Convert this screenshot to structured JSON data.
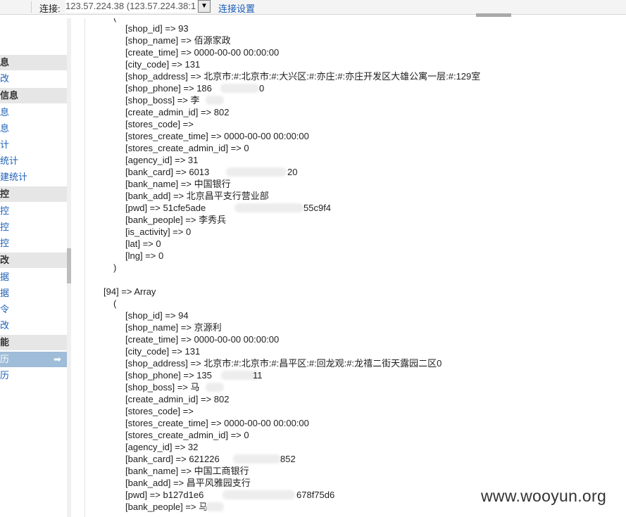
{
  "topbar": {
    "connection_label": "连接:",
    "connection_value": "123.57.224.38 (123.57.224.38:1",
    "dropdown_glyph": "▼",
    "settings_link": "连接设置"
  },
  "sidebar": {
    "items": [
      {
        "label": "息",
        "kind": "header"
      },
      {
        "label": "改",
        "kind": "link"
      },
      {
        "label": "信息",
        "kind": "header"
      },
      {
        "label": "息",
        "kind": "link"
      },
      {
        "label": "息",
        "kind": "link"
      },
      {
        "label": "计",
        "kind": "link"
      },
      {
        "label": "统计",
        "kind": "link"
      },
      {
        "label": "建统计",
        "kind": "link"
      },
      {
        "label": "控",
        "kind": "header"
      },
      {
        "label": "控",
        "kind": "link"
      },
      {
        "label": "控",
        "kind": "link"
      },
      {
        "label": "控",
        "kind": "link"
      },
      {
        "label": "改",
        "kind": "header"
      },
      {
        "label": "据",
        "kind": "link"
      },
      {
        "label": "据",
        "kind": "link"
      },
      {
        "label": "令",
        "kind": "link"
      },
      {
        "label": "改",
        "kind": "link"
      },
      {
        "label": "能",
        "kind": "header"
      },
      {
        "label": "历",
        "kind": "active"
      },
      {
        "label": "历",
        "kind": "link"
      }
    ],
    "active_arrow": "➡"
  },
  "content": {
    "top_paren": "(",
    "record_93": {
      "lines": [
        "[shop_id] => 93",
        "[shop_name] => 佰源家政",
        "[create_time] => 0000-00-00 00:00:00",
        "[city_code] => 131",
        "[shop_address] => 北京市:#:北京市:#:大兴区:#:亦庄:#:亦庄开发区大雄公寓一层:#:129室",
        "[shop_phone] => 186",
        "[shop_boss] => 李",
        "[create_admin_id] => 802",
        "[stores_code] =>",
        "[stores_create_time] => 0000-00-00 00:00:00",
        "[stores_create_admin_id] => 0",
        "[agency_id] => 31",
        "[bank_card] => 6013",
        "[bank_name] => 中国银行",
        "[bank_add] => 北京昌平支行营业部",
        "[pwd] => 51cfe5ade",
        "[bank_people] => 李秀兵",
        "[is_activity] => 0",
        "[lat] => 0",
        "[lng] => 0"
      ],
      "phone_tail": "0",
      "card_tail": "20",
      "pwd_tail": "55c9f4",
      "close_paren": ")"
    },
    "record_94": {
      "index_line": "[94] => Array",
      "open_paren": "(",
      "lines": [
        "[shop_id] => 94",
        "[shop_name] => 京源利",
        "[create_time] => 0000-00-00 00:00:00",
        "[city_code] => 131",
        "[shop_address] => 北京市:#:北京市:#:昌平区:#:回龙观:#:龙禧二街天露园二区0",
        "[shop_phone] => 135",
        "[shop_boss] => 马",
        "[create_admin_id] => 802",
        "[stores_code] =>",
        "[stores_create_time] => 0000-00-00 00:00:00",
        "[stores_create_admin_id] => 0",
        "[agency_id] => 32",
        "[bank_card] => 621226",
        "[bank_name] => 中国工商银行",
        "[bank_add] => 昌平风雅园支行",
        "[pwd] => b127d1e6",
        "[bank_people] => 马"
      ],
      "phone_tail": "11",
      "card_tail": "852",
      "pwd_tail": "678f75d6"
    }
  },
  "watermark": "www.wooyun.org"
}
